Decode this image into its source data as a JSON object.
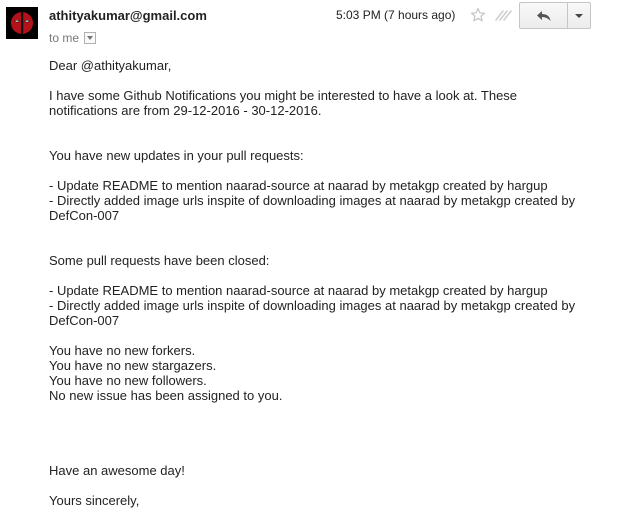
{
  "header": {
    "sender": "athityakumar@gmail.com",
    "to_label": "to me",
    "timestamp": "5:03 PM (7 hours ago)"
  },
  "icons": {
    "avatar": "deadpool-avatar",
    "star": "star-icon",
    "reply": "reply-arrow-icon",
    "more": "chevron-down-icon"
  },
  "email_body": {
    "greeting": "Dear @athityakumar,",
    "intro_1": "I have some Github Notifications you might be interested to have a look at. These",
    "intro_2": "notifications are from 29-12-2016 - 30-12-2016.",
    "updates_heading": "You have new updates in your pull requests:",
    "updates": [
      "- Update README to mention naarad-source at naarad by metakgp created by hargup",
      "- Directly added image urls inspite of downloading images at naarad by metakgp created by",
      "DefCon-007"
    ],
    "closed_heading": "Some pull requests have been closed:",
    "closed": [
      "- Update README to mention naarad-source at naarad by metakgp created by hargup",
      "- Directly added image urls inspite of downloading images at naarad by metakgp created by",
      "DefCon-007"
    ],
    "stats": [
      "You have no new forkers.",
      "You have no new stargazers.",
      "You have no new followers.",
      "No new issue has been assigned to you."
    ],
    "closing": "Have an awesome day!",
    "signoff": "Yours sincerely,"
  }
}
